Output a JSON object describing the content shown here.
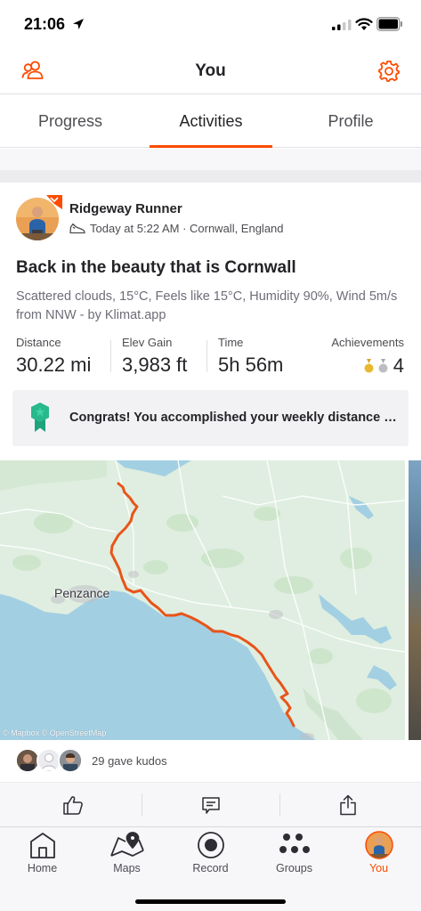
{
  "status_bar": {
    "time": "21:06"
  },
  "header": {
    "title": "You"
  },
  "tabs": [
    {
      "label": "Progress"
    },
    {
      "label": "Activities"
    },
    {
      "label": "Profile"
    }
  ],
  "activity": {
    "athlete_name": "Ridgeway Runner",
    "meta": "Today at 5:22 AM · Cornwall, England",
    "title": "Back in the beauty that is Cornwall",
    "description": "Scattered clouds, 15°C, Feels like 15°C, Humidity 90%, Wind 5m/s from NNW - by Klimat.app",
    "stats": {
      "distance_label": "Distance",
      "distance_value": "30.22 mi",
      "elev_label": "Elev Gain",
      "elev_value": "3,983 ft",
      "time_label": "Time",
      "time_value": "5h 56m",
      "achievements_label": "Achievements",
      "achievements_value": "4"
    },
    "goal_text": "Congrats! You accomplished your weekly distance goal!",
    "map": {
      "place_label": "Penzance",
      "attribution": "© Mapbox © OpenStreetMap"
    },
    "kudos_text": "29 gave kudos"
  },
  "bottom_nav": [
    {
      "label": "Home"
    },
    {
      "label": "Maps"
    },
    {
      "label": "Record"
    },
    {
      "label": "Groups"
    },
    {
      "label": "You"
    }
  ],
  "colors": {
    "accent": "#fc4c02",
    "route": "#e8541a",
    "map_land": "#dfeee0",
    "map_water": "#a3cfe3"
  },
  "icons": [
    "location-arrow-icon",
    "signal-icon",
    "wifi-icon",
    "battery-icon",
    "friends-icon",
    "gear-icon",
    "shoe-icon",
    "gold-medal-icon",
    "silver-medal-icon",
    "goal-badge-icon",
    "thumbs-up-icon",
    "comment-icon",
    "share-icon",
    "home-icon",
    "maps-icon",
    "record-icon",
    "groups-icon"
  ]
}
